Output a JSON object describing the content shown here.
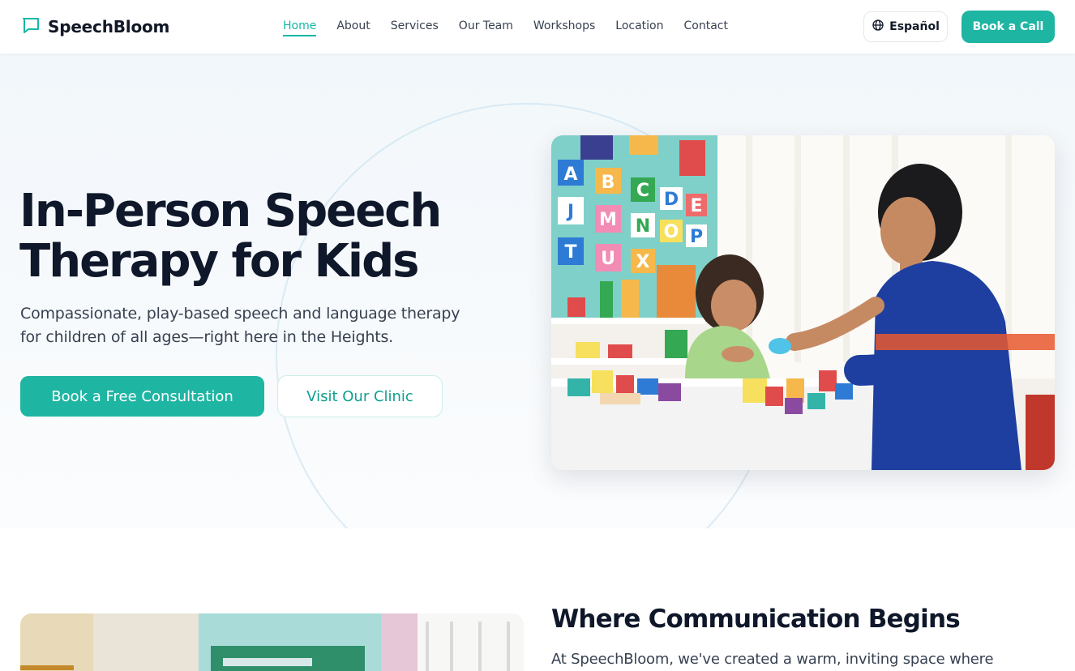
{
  "header": {
    "logo_text": "SpeechBloom",
    "nav": [
      {
        "label": "Home",
        "active": true
      },
      {
        "label": "About"
      },
      {
        "label": "Services"
      },
      {
        "label": "Our Team"
      },
      {
        "label": "Workshops"
      },
      {
        "label": "Location"
      },
      {
        "label": "Contact"
      }
    ],
    "language_label": "Español",
    "cta_label": "Book a Call"
  },
  "hero": {
    "title_line1": "In-Person Speech",
    "title_line2": "Therapy for Kids",
    "subtitle_line1": "Compassionate, play-based speech and language therapy",
    "subtitle_line2": "for children of all ages—right here in the Heights.",
    "primary_button": "Book a Free Consultation",
    "secondary_button": "Visit Our Clinic",
    "image_letters": [
      "A",
      "B",
      "C",
      "D",
      "E",
      "J",
      "M",
      "N",
      "O",
      "P",
      "T",
      "U",
      "X"
    ]
  },
  "section2": {
    "title": "Where Communication Begins",
    "text": "At SpeechBloom, we've created a warm, inviting space where"
  },
  "colors": {
    "accent": "#1fb5a3",
    "heading": "#0f172a",
    "body_text": "#374151",
    "hero_bg": "#f2f7fb"
  },
  "icons": {
    "logo": "chat-bubble-icon",
    "language": "globe-icon"
  }
}
